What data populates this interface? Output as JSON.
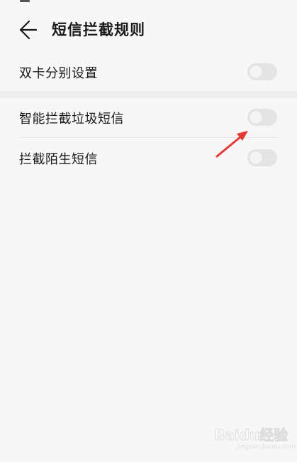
{
  "header": {
    "back_icon": "arrow-left-icon",
    "title": "短信拦截规则"
  },
  "settings": {
    "dual_card": {
      "label": "双卡分别设置",
      "enabled": false
    },
    "smart_spam": {
      "label": "智能拦截垃圾短信",
      "enabled": false
    },
    "stranger": {
      "label": "拦截陌生短信",
      "enabled": false
    }
  },
  "annotation": {
    "icon": "red-arrow-icon",
    "color": "#e53935"
  },
  "watermark": {
    "logo": "Baidu经验",
    "domain": "jingyan.baidu.com"
  },
  "colors": {
    "background": "#f7f7f7",
    "toggle_off": "#e4e4e4",
    "text": "#1a1a1a"
  }
}
